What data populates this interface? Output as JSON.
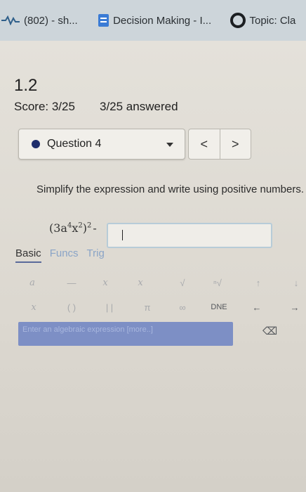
{
  "browser": {
    "tabs": [
      {
        "label": "(802) - sh...",
        "icon": "chart-icon"
      },
      {
        "label": "Decision Making - I...",
        "icon": "document-icon"
      },
      {
        "label": "Topic: Cla",
        "icon": "circle-icon"
      }
    ]
  },
  "page": {
    "section": "1.2",
    "score": "Score: 3/25",
    "answered": "3/25 answered",
    "question_selector": "Question 4",
    "nav_prev": "<",
    "nav_next": ">",
    "instruction": "Simplify the expression and write using positive numbers.",
    "expression": {
      "base": "(3a",
      "exp_a": "4",
      "mid": "x",
      "exp_x": "2",
      "close": ")",
      "outer_exp": "2",
      "tail": "-"
    },
    "answer_value": ""
  },
  "keyboard": {
    "tabs": [
      "Basic",
      "Funcs",
      "Trig"
    ],
    "row1": [
      "a",
      "—",
      "x",
      "x",
      "√",
      "ⁿ√",
      "↑",
      "↓"
    ],
    "row2": [
      "x",
      "( )",
      "|  |",
      "π",
      "∞",
      "DNE",
      "←",
      "→"
    ],
    "help": "Enter an algebraic expression [more..]",
    "backspace": "⌫"
  }
}
